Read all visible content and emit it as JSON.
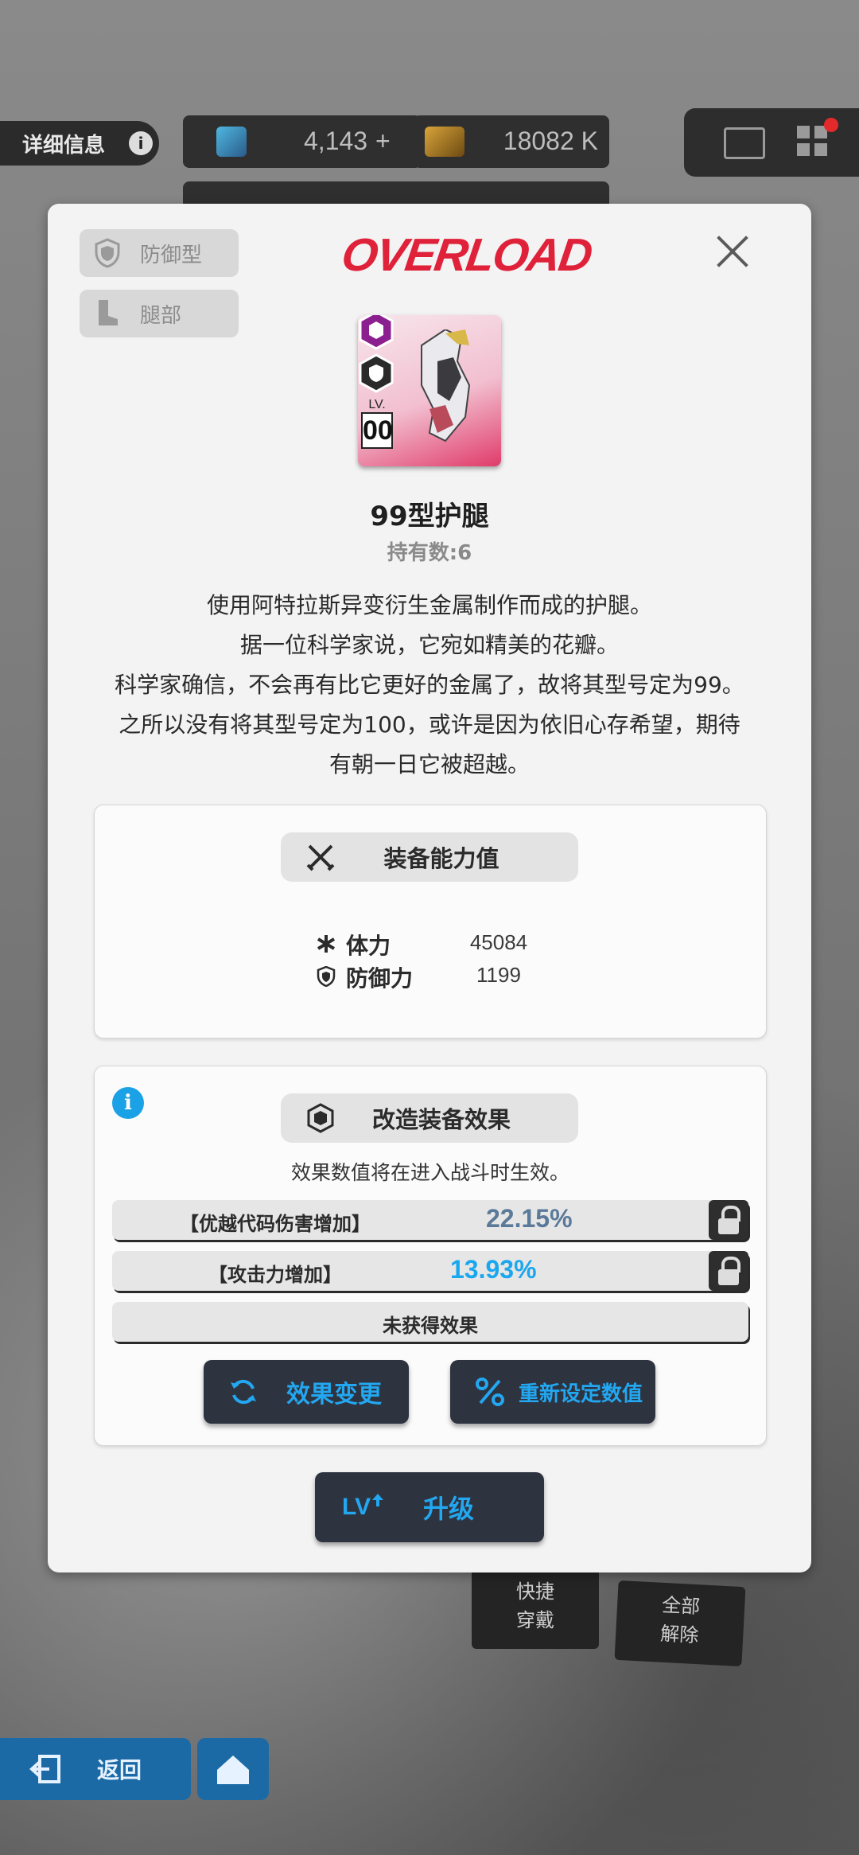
{
  "hud": {
    "detail_label": "详细信息",
    "res1_value": "4,143",
    "res1_plus": "+",
    "res2_value": "18082 K"
  },
  "modal": {
    "tags": [
      {
        "label": "防御型",
        "icon": "shield-icon"
      },
      {
        "label": "腿部",
        "icon": "boot-icon"
      }
    ],
    "logo": "OVERLOAD",
    "item": {
      "level_prefix": "LV.",
      "level": "00",
      "name": "99型护腿",
      "owned": "持有数:6"
    },
    "description": [
      "使用阿特拉斯异变衍生金属制作而成的护腿。",
      "据一位科学家说，它宛如精美的花瓣。",
      "科学家确信，不会再有比它更好的金属了，故将其型号定为99。",
      "之所以没有将其型号定为100，或许是因为依旧心存希望，期待",
      "有朝一日它被超越。"
    ],
    "stats_panel": {
      "title": "装备能力值",
      "stats": [
        {
          "name": "体力",
          "value": "45084",
          "icon": "asterisk-icon"
        },
        {
          "name": "防御力",
          "value": "1199",
          "icon": "shield-icon"
        }
      ]
    },
    "effects_panel": {
      "title": "改造装备效果",
      "note": "效果数值将在进入战斗时生效。",
      "effects": [
        {
          "name": "【优越代码伤害增加】",
          "value": "22.15%",
          "color": "#5b7a99"
        },
        {
          "name": "【攻击力增加】",
          "value": "13.93%",
          "color": "#1aa7ee"
        }
      ],
      "empty_label": "未获得效果",
      "btn_change": "效果变更",
      "btn_reset": "重新设定数值"
    },
    "upgrade": {
      "prefix": "LV",
      "label": "升级"
    }
  },
  "behind": {
    "quick_equip": [
      "快捷",
      "穿戴"
    ],
    "remove_all": [
      "全部",
      "解除"
    ],
    "back_label": "返回"
  },
  "colors": {
    "accent": "#22a7f0",
    "logo": "#e0213a"
  }
}
